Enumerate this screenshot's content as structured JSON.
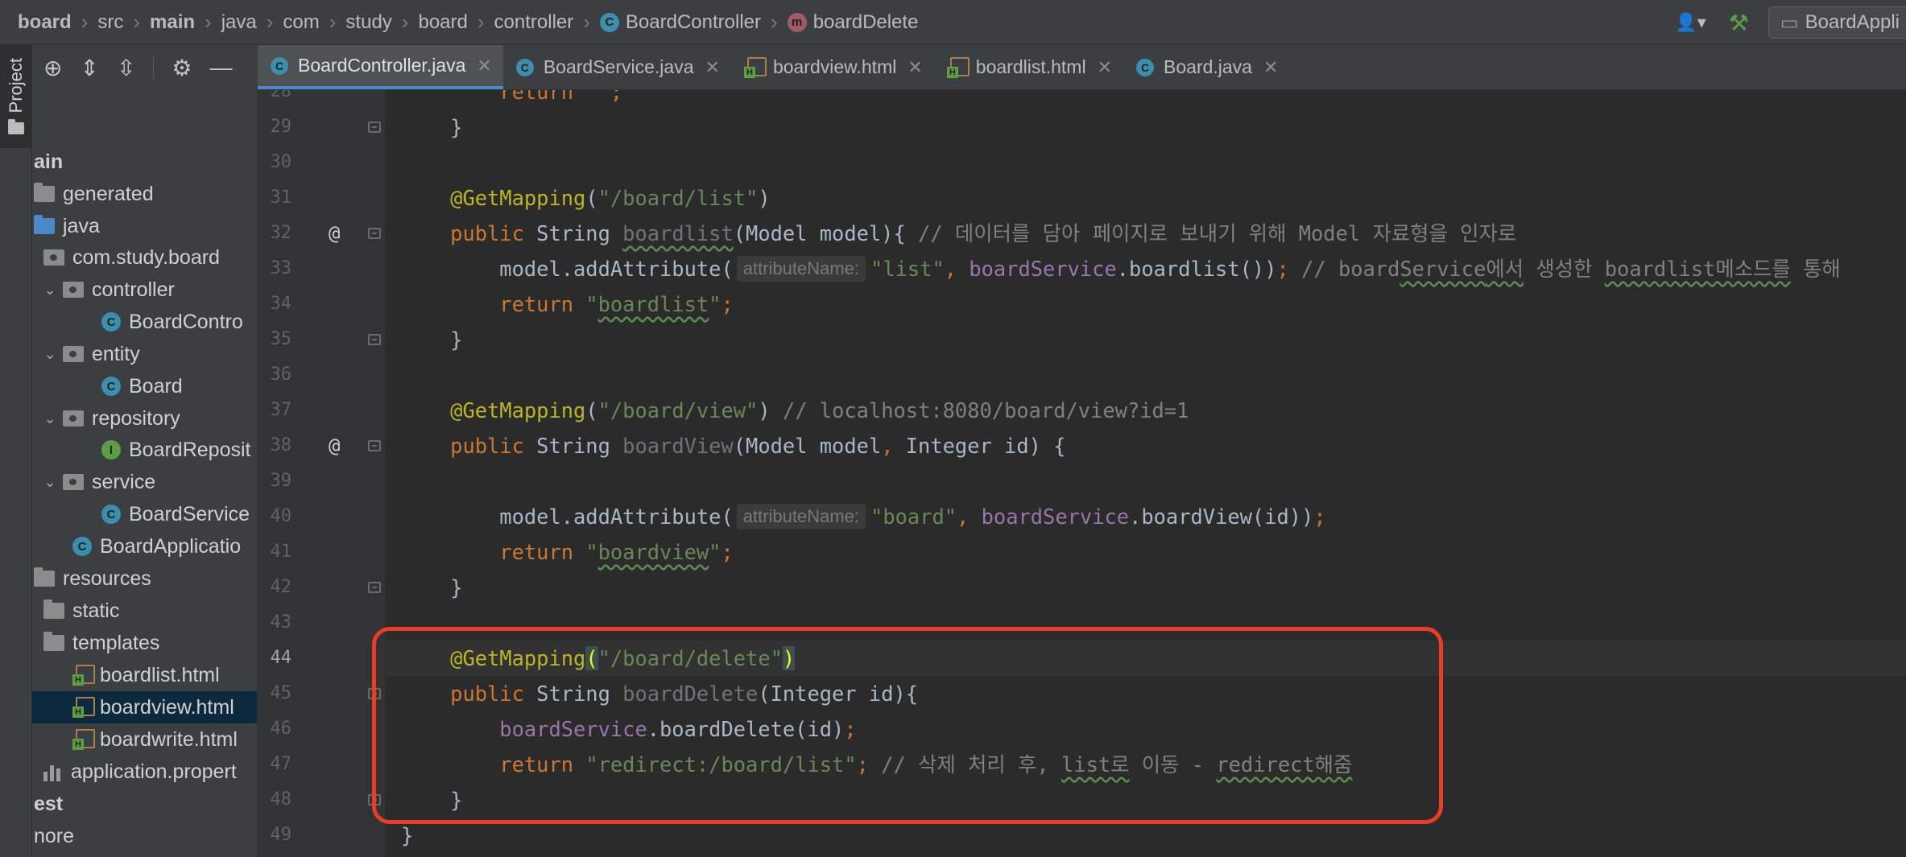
{
  "breadcrumb": [
    {
      "label": "board",
      "bold": true
    },
    {
      "label": "src",
      "bold": false
    },
    {
      "label": "main",
      "bold": true
    },
    {
      "label": "java",
      "bold": false
    },
    {
      "label": "com",
      "bold": false
    },
    {
      "label": "study",
      "bold": false
    },
    {
      "label": "board",
      "bold": false
    },
    {
      "label": "controller",
      "bold": false
    },
    {
      "label": "BoardController",
      "bold": false,
      "icon": "class-icon"
    },
    {
      "label": "boardDelete",
      "bold": false,
      "icon": "method-icon"
    }
  ],
  "toolbar": {
    "run_config_label": "BoardAppli",
    "user_icon": "user-icon",
    "build_icon": "hammer-icon"
  },
  "tool_window": {
    "project_tab_label": "Project"
  },
  "project_tree": [
    {
      "label": "ain",
      "depth": 0,
      "kind": "none",
      "bold": true
    },
    {
      "label": "generated",
      "depth": 0,
      "kind": "folder"
    },
    {
      "label": "java",
      "depth": 0,
      "kind": "src-folder"
    },
    {
      "label": "com.study.board",
      "depth": 1,
      "kind": "package"
    },
    {
      "label": "controller",
      "depth": 1,
      "kind": "package",
      "expanded": true
    },
    {
      "label": "BoardContro",
      "depth": 3,
      "kind": "class"
    },
    {
      "label": "entity",
      "depth": 1,
      "kind": "package",
      "expanded": true
    },
    {
      "label": "Board",
      "depth": 3,
      "kind": "class"
    },
    {
      "label": "repository",
      "depth": 1,
      "kind": "package",
      "expanded": true
    },
    {
      "label": "BoardReposit",
      "depth": 3,
      "kind": "interface"
    },
    {
      "label": "service",
      "depth": 1,
      "kind": "package",
      "expanded": true
    },
    {
      "label": "BoardService",
      "depth": 3,
      "kind": "class"
    },
    {
      "label": "BoardApplicatio",
      "depth": 2,
      "kind": "app-class"
    },
    {
      "label": "resources",
      "depth": 0,
      "kind": "folder"
    },
    {
      "label": "static",
      "depth": 1,
      "kind": "folder"
    },
    {
      "label": "templates",
      "depth": 1,
      "kind": "folder"
    },
    {
      "label": "boardlist.html",
      "depth": 2,
      "kind": "html"
    },
    {
      "label": "boardview.html",
      "depth": 2,
      "kind": "html",
      "selected": true
    },
    {
      "label": "boardwrite.html",
      "depth": 2,
      "kind": "html"
    },
    {
      "label": "application.propert",
      "depth": 1,
      "kind": "properties"
    },
    {
      "label": "est",
      "depth": 0,
      "kind": "none",
      "bold": true
    },
    {
      "label": "nore",
      "depth": 0,
      "kind": "none"
    }
  ],
  "editor_tabs": [
    {
      "label": "BoardController.java",
      "kind": "class",
      "active": true
    },
    {
      "label": "BoardService.java",
      "kind": "class"
    },
    {
      "label": "boardview.html",
      "kind": "html"
    },
    {
      "label": "boardlist.html",
      "kind": "html"
    },
    {
      "label": "Board.java",
      "kind": "class"
    }
  ],
  "editor": {
    "current_line": 44,
    "lines": [
      {
        "n": 28,
        "tokens": [
          {
            "t": "        ",
            "c": ""
          },
          {
            "t": "return",
            "c": "k"
          },
          {
            "t": " \"\"",
            "c": "str"
          },
          {
            "t": ";",
            "c": "k"
          }
        ]
      },
      {
        "n": 29,
        "tokens": [
          {
            "t": "    }",
            "c": ""
          }
        ],
        "fold": true
      },
      {
        "n": 30,
        "tokens": []
      },
      {
        "n": 31,
        "tokens": [
          {
            "t": "    ",
            "c": ""
          },
          {
            "t": "@GetMapping",
            "c": "ann"
          },
          {
            "t": "(",
            "c": ""
          },
          {
            "t": "\"/board/list\"",
            "c": "str"
          },
          {
            "t": ")",
            "c": ""
          }
        ]
      },
      {
        "n": 32,
        "gutter": "@",
        "fold": true,
        "tokens": [
          {
            "t": "    ",
            "c": ""
          },
          {
            "t": "public",
            "c": "k"
          },
          {
            "t": " String ",
            "c": ""
          },
          {
            "t": "boardlist",
            "c": "uns sq"
          },
          {
            "t": "(Model model){ ",
            "c": ""
          },
          {
            "t": "// 데이터를 담아 페이지로 보내기 위해 Model 자료형을 인자로",
            "c": "cmt"
          }
        ]
      },
      {
        "n": 33,
        "tokens": [
          {
            "t": "        model.addAttribute(",
            "c": ""
          },
          {
            "hint": "attributeName:"
          },
          {
            "t": "\"list\"",
            "c": "str"
          },
          {
            "t": ", ",
            "c": "k"
          },
          {
            "t": "boardService",
            "c": "fld"
          },
          {
            "t": ".boardlist())",
            "c": ""
          },
          {
            "t": ";",
            "c": "k"
          },
          {
            "t": " // board",
            "c": "cmt"
          },
          {
            "t": "Service",
            "c": "cmt sq"
          },
          {
            "t": "에서",
            "c": "cmt sq"
          },
          {
            "t": " 생성한 ",
            "c": "cmt"
          },
          {
            "t": "boardlist메소드를",
            "c": "cmt sq"
          },
          {
            "t": " 통해 ",
            "c": "cmt"
          }
        ]
      },
      {
        "n": 34,
        "tokens": [
          {
            "t": "        ",
            "c": ""
          },
          {
            "t": "return",
            "c": "k"
          },
          {
            "t": " \"",
            "c": "str"
          },
          {
            "t": "boardlist",
            "c": "str sq"
          },
          {
            "t": "\"",
            "c": "str"
          },
          {
            "t": ";",
            "c": "k"
          }
        ]
      },
      {
        "n": 35,
        "fold": true,
        "tokens": [
          {
            "t": "    }",
            "c": ""
          }
        ]
      },
      {
        "n": 36,
        "tokens": []
      },
      {
        "n": 37,
        "tokens": [
          {
            "t": "    ",
            "c": ""
          },
          {
            "t": "@GetMapping",
            "c": "ann"
          },
          {
            "t": "(",
            "c": ""
          },
          {
            "t": "\"/board/view\"",
            "c": "str"
          },
          {
            "t": ") ",
            "c": ""
          },
          {
            "t": "// localhost:8080/board/view?id=1",
            "c": "cmt"
          }
        ]
      },
      {
        "n": 38,
        "gutter": "@",
        "fold": true,
        "tokens": [
          {
            "t": "    ",
            "c": ""
          },
          {
            "t": "public",
            "c": "k"
          },
          {
            "t": " String ",
            "c": ""
          },
          {
            "t": "boardView",
            "c": "uns"
          },
          {
            "t": "(Model model",
            "c": ""
          },
          {
            "t": ",",
            "c": "k"
          },
          {
            "t": " Integer id) {",
            "c": ""
          }
        ]
      },
      {
        "n": 39,
        "tokens": []
      },
      {
        "n": 40,
        "tokens": [
          {
            "t": "        model.addAttribute(",
            "c": ""
          },
          {
            "hint": "attributeName:"
          },
          {
            "t": "\"board\"",
            "c": "str"
          },
          {
            "t": ", ",
            "c": "k"
          },
          {
            "t": "boardService",
            "c": "fld"
          },
          {
            "t": ".boardView(id))",
            "c": ""
          },
          {
            "t": ";",
            "c": "k"
          }
        ]
      },
      {
        "n": 41,
        "tokens": [
          {
            "t": "        ",
            "c": ""
          },
          {
            "t": "return",
            "c": "k"
          },
          {
            "t": " \"",
            "c": "str"
          },
          {
            "t": "boardview",
            "c": "str sq"
          },
          {
            "t": "\"",
            "c": "str"
          },
          {
            "t": ";",
            "c": "k"
          }
        ]
      },
      {
        "n": 42,
        "fold": true,
        "tokens": [
          {
            "t": "    }",
            "c": ""
          }
        ]
      },
      {
        "n": 43,
        "tokens": []
      },
      {
        "n": 44,
        "tokens": [
          {
            "t": "    ",
            "c": ""
          },
          {
            "t": "@GetMapping",
            "c": "ann"
          },
          {
            "t": "(",
            "c": "brace-hl"
          },
          {
            "t": "\"/board/delete\"",
            "c": "str"
          },
          {
            "t": ")",
            "c": "brace-hl"
          }
        ]
      },
      {
        "n": 45,
        "fold": true,
        "tokens": [
          {
            "t": "    ",
            "c": ""
          },
          {
            "t": "public",
            "c": "k"
          },
          {
            "t": " String ",
            "c": ""
          },
          {
            "t": "boardDelete",
            "c": "uns"
          },
          {
            "t": "(Integer id){",
            "c": ""
          }
        ]
      },
      {
        "n": 46,
        "tokens": [
          {
            "t": "        ",
            "c": ""
          },
          {
            "t": "boardService",
            "c": "fld"
          },
          {
            "t": ".boardDelete(id)",
            "c": ""
          },
          {
            "t": ";",
            "c": "k"
          }
        ]
      },
      {
        "n": 47,
        "tokens": [
          {
            "t": "        ",
            "c": ""
          },
          {
            "t": "return",
            "c": "k"
          },
          {
            "t": " \"redirect:/board/list\"",
            "c": "str"
          },
          {
            "t": ";",
            "c": "k"
          },
          {
            "t": " // 삭제 처리 후, ",
            "c": "cmt"
          },
          {
            "t": "list로",
            "c": "cmt sq"
          },
          {
            "t": " 이동 - ",
            "c": "cmt"
          },
          {
            "t": "redirect해줌",
            "c": "cmt sq"
          }
        ]
      },
      {
        "n": 48,
        "fold": true,
        "tokens": [
          {
            "t": "    }",
            "c": ""
          }
        ]
      },
      {
        "n": 49,
        "tokens": [
          {
            "t": "}",
            "c": ""
          }
        ]
      }
    ]
  },
  "annotation": {
    "box_color": "#ea3d27"
  },
  "colors": {
    "keyword": "#cc7832",
    "annotation": "#bbb529",
    "string": "#6a8759",
    "field": "#9876aa",
    "comment": "#808080",
    "accent": "#4a88c7"
  }
}
